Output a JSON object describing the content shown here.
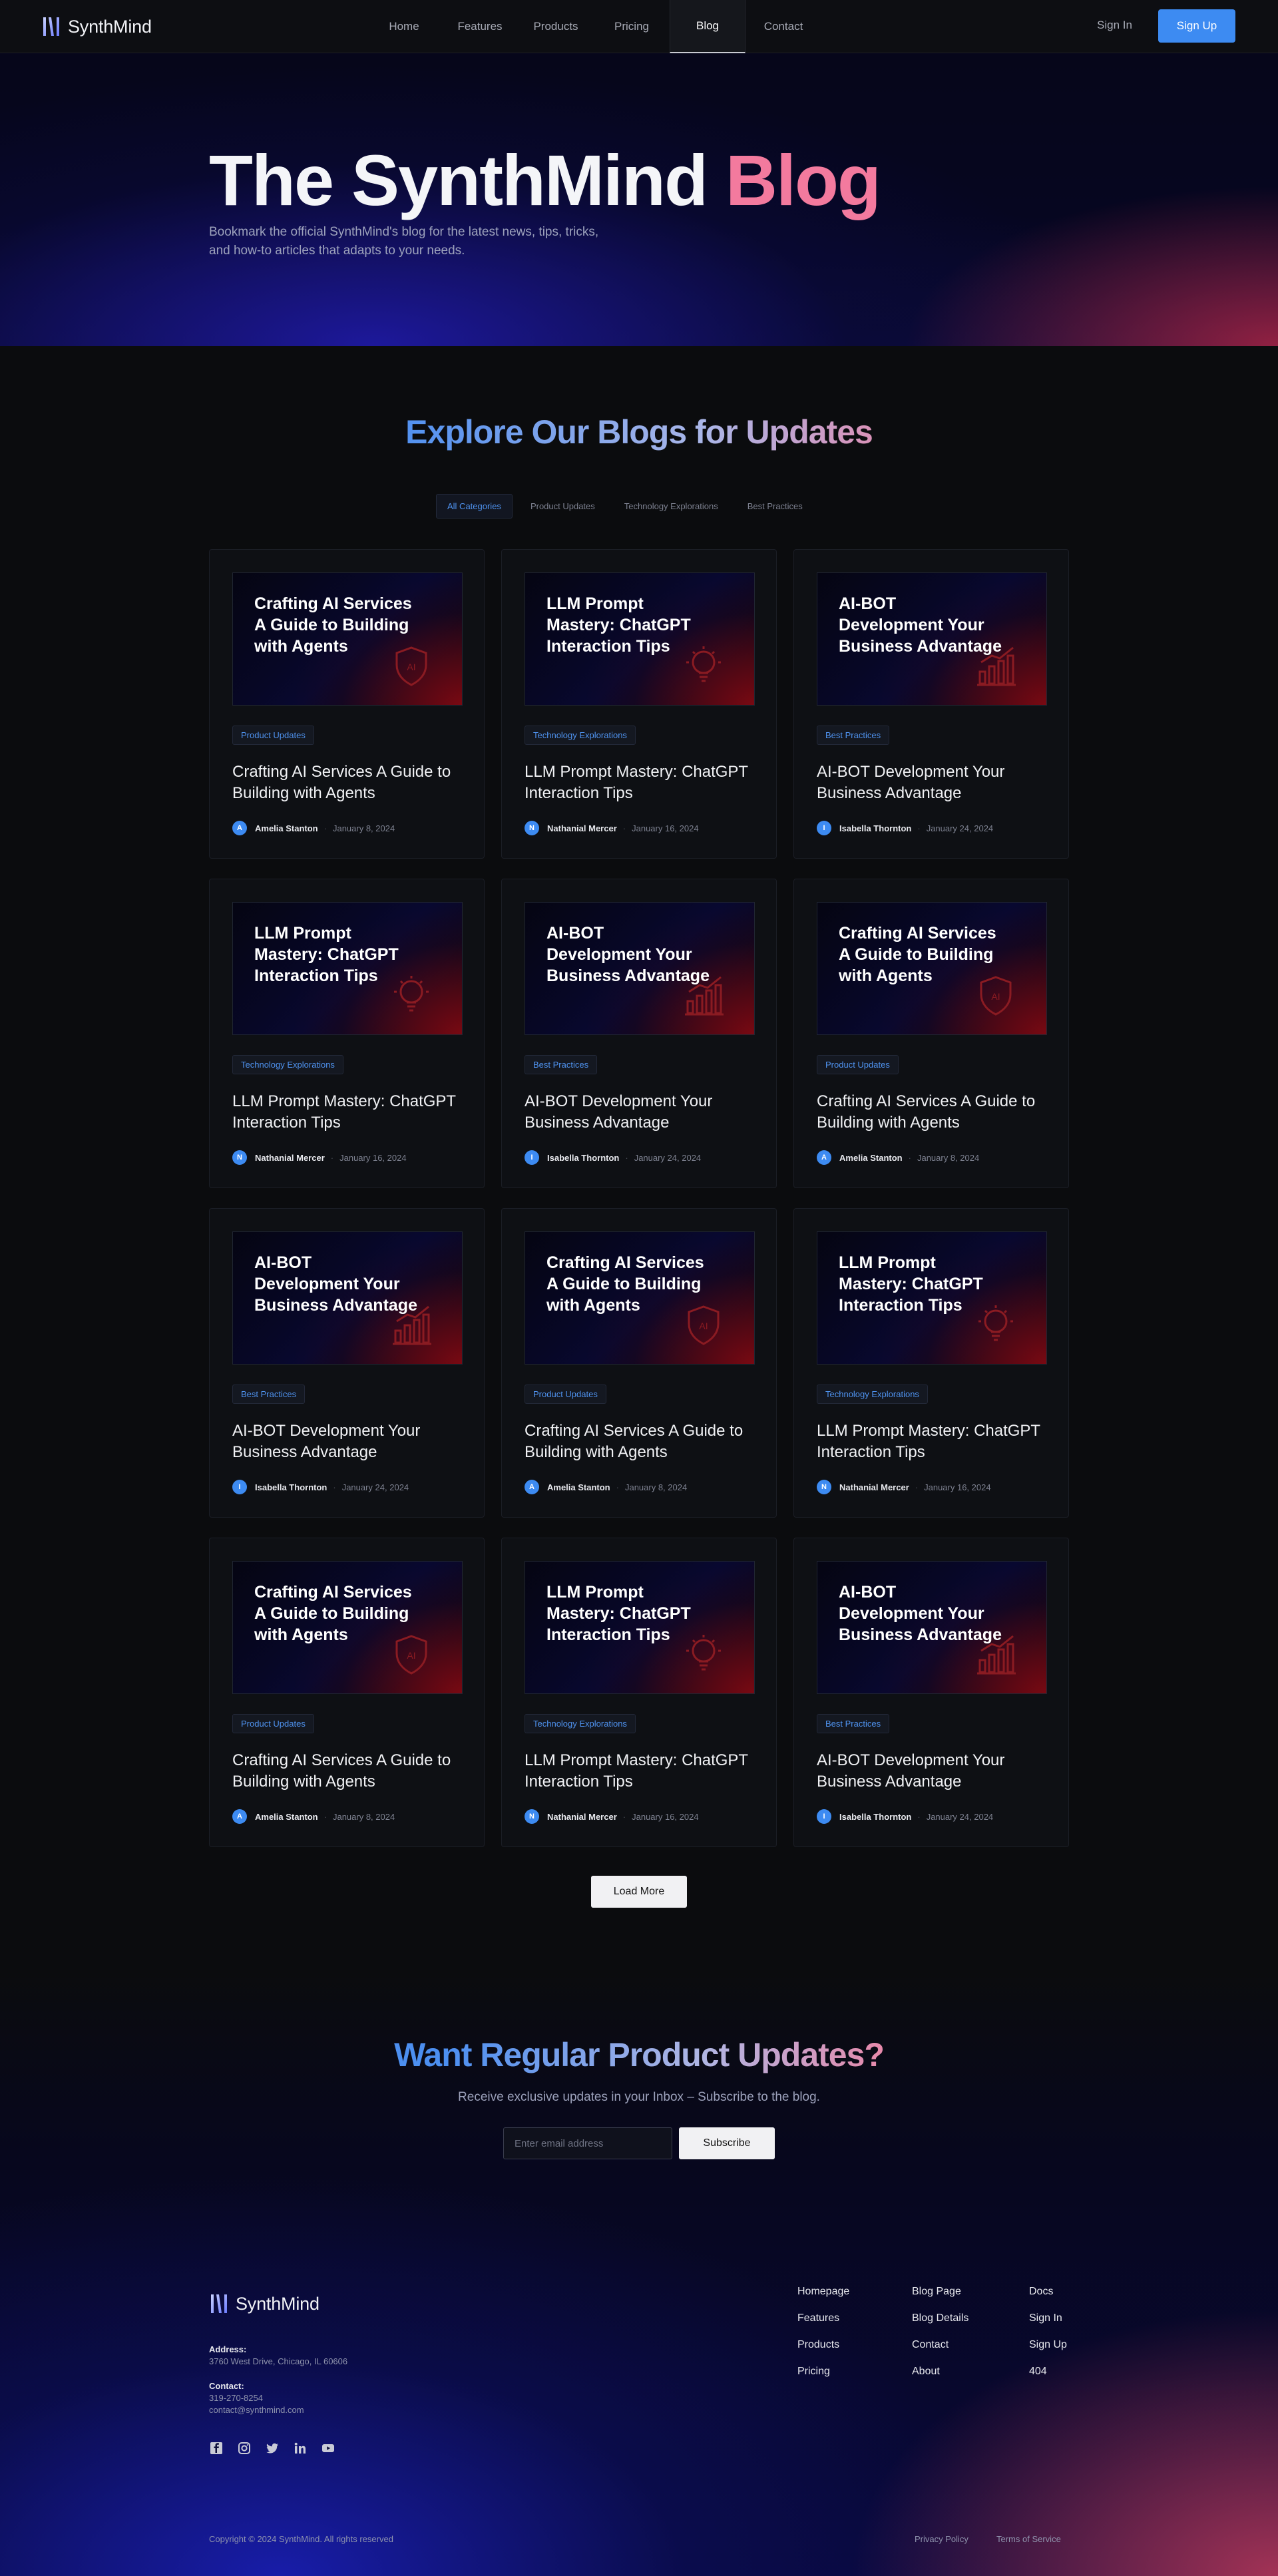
{
  "brand": {
    "name": "SynthMind"
  },
  "nav": {
    "items": [
      {
        "label": "Home",
        "active": false
      },
      {
        "label": "Features",
        "active": false
      },
      {
        "label": "Products",
        "active": false
      },
      {
        "label": "Pricing",
        "active": false
      },
      {
        "label": "Blog",
        "active": true
      },
      {
        "label": "Contact",
        "active": false
      }
    ],
    "signin": "Sign In",
    "signup": "Sign Up"
  },
  "hero": {
    "title_main": "The SynthMind",
    "title_accent": "Blog",
    "subtitle": "Bookmark the official SynthMind's blog for the latest news, tips, tricks, and how-to articles that adapts to your needs."
  },
  "blog": {
    "title": "Explore Our Blogs for Updates",
    "filters": [
      "All Categories",
      "Product Updates",
      "Technology Explorations",
      "Best Practices"
    ],
    "active_filter": "All Categories",
    "cards": [
      {
        "thumb_title": "Crafting AI Services A Guide to Building with Agents",
        "icon": "shield-icon",
        "tag": "Product Updates",
        "title": "Crafting AI Services A Guide to Building with Agents",
        "avatar": "A",
        "author": "Amelia Stanton",
        "date": "January 8, 2024"
      },
      {
        "thumb_title": "LLM Prompt Mastery: ChatGPT Interaction Tips",
        "icon": "lightbulb-icon",
        "tag": "Technology Explorations",
        "title": "LLM Prompt Mastery: ChatGPT Interaction Tips",
        "avatar": "N",
        "author": "Nathanial Mercer",
        "date": "January 16, 2024"
      },
      {
        "thumb_title": "AI-BOT Development Your Business Advantage",
        "icon": "bar-chart-icon",
        "tag": "Best Practices",
        "title": "AI-BOT Development Your Business Advantage",
        "avatar": "I",
        "author": "Isabella Thornton",
        "date": "January 24, 2024"
      },
      {
        "thumb_title": "LLM Prompt Mastery: ChatGPT Interaction Tips",
        "icon": "lightbulb-icon",
        "tag": "Technology Explorations",
        "title": "LLM Prompt Mastery: ChatGPT Interaction Tips",
        "avatar": "N",
        "author": "Nathanial Mercer",
        "date": "January 16, 2024"
      },
      {
        "thumb_title": "AI-BOT Development Your Business Advantage",
        "icon": "bar-chart-icon",
        "tag": "Best Practices",
        "title": "AI-BOT Development Your Business Advantage",
        "avatar": "I",
        "author": "Isabella Thornton",
        "date": "January 24, 2024"
      },
      {
        "thumb_title": "Crafting AI Services A Guide to Building with Agents",
        "icon": "shield-icon",
        "tag": "Product Updates",
        "title": "Crafting AI Services A Guide to Building with Agents",
        "avatar": "A",
        "author": "Amelia Stanton",
        "date": "January 8, 2024"
      },
      {
        "thumb_title": "AI-BOT Development Your Business Advantage",
        "icon": "bar-chart-icon",
        "tag": "Best Practices",
        "title": "AI-BOT Development Your Business Advantage",
        "avatar": "I",
        "author": "Isabella Thornton",
        "date": "January 24, 2024"
      },
      {
        "thumb_title": "Crafting AI Services A Guide to Building with Agents",
        "icon": "shield-icon",
        "tag": "Product Updates",
        "title": "Crafting AI Services A Guide to Building with Agents",
        "avatar": "A",
        "author": "Amelia Stanton",
        "date": "January 8, 2024"
      },
      {
        "thumb_title": "LLM Prompt Mastery: ChatGPT Interaction Tips",
        "icon": "lightbulb-icon",
        "tag": "Technology Explorations",
        "title": "LLM Prompt Mastery: ChatGPT Interaction Tips",
        "avatar": "N",
        "author": "Nathanial Mercer",
        "date": "January 16, 2024"
      },
      {
        "thumb_title": "Crafting AI Services A Guide to Building with Agents",
        "icon": "shield-icon",
        "tag": "Product Updates",
        "title": "Crafting AI Services A Guide to Building with Agents",
        "avatar": "A",
        "author": "Amelia Stanton",
        "date": "January 8, 2024"
      },
      {
        "thumb_title": "LLM Prompt Mastery: ChatGPT Interaction Tips",
        "icon": "lightbulb-icon",
        "tag": "Technology Explorations",
        "title": "LLM Prompt Mastery: ChatGPT Interaction Tips",
        "avatar": "N",
        "author": "Nathanial Mercer",
        "date": "January 16, 2024"
      },
      {
        "thumb_title": "AI-BOT Development Your Business Advantage",
        "icon": "bar-chart-icon",
        "tag": "Best Practices",
        "title": "AI-BOT Development Your Business Advantage",
        "avatar": "I",
        "author": "Isabella Thornton",
        "date": "January 24, 2024"
      }
    ],
    "load_more": "Load More"
  },
  "newsletter": {
    "title": "Want Regular Product Updates?",
    "subtitle": "Receive exclusive updates in your Inbox – Subscribe to the blog.",
    "email_placeholder": "Enter email address",
    "subscribe": "Subscribe"
  },
  "footer": {
    "address_label": "Address:",
    "address": "3760 West Drive, Chicago, IL 60606",
    "contact_label": "Contact:",
    "phone": "319-270-8254",
    "email": "contact@synthmind.com",
    "socials": [
      "facebook-icon",
      "instagram-icon",
      "twitter-icon",
      "linkedin-icon",
      "youtube-icon"
    ],
    "columns": [
      [
        "Homepage",
        "Features",
        "Products",
        "Pricing"
      ],
      [
        "Blog Page",
        "Blog Details",
        "Contact",
        "About"
      ],
      [
        "Docs",
        "Sign In",
        "Sign Up",
        "404"
      ]
    ],
    "copyright": "Copyright © 2024 SynthMind. All rights reserved",
    "privacy": "Privacy Policy",
    "terms": "Terms of Service"
  },
  "colors": {
    "accent_blue": "#3d8bf2",
    "accent_pink": "#f37a9e",
    "tag_blue": "#4f93f0",
    "background": "#0b0c0e"
  }
}
